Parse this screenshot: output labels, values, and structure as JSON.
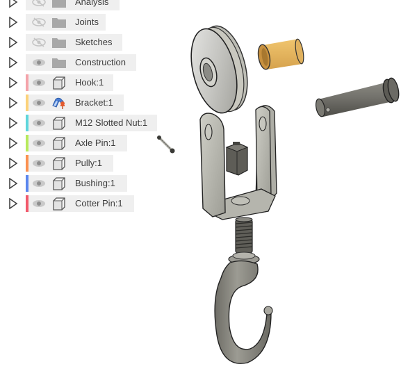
{
  "browser": {
    "items": [
      {
        "label": "Analysis",
        "type": "folder",
        "visible": false,
        "color": null
      },
      {
        "label": "Joints",
        "type": "folder",
        "visible": false,
        "color": null
      },
      {
        "label": "Sketches",
        "type": "folder",
        "visible": false,
        "color": null
      },
      {
        "label": "Construction",
        "type": "folder",
        "visible": true,
        "color": null
      },
      {
        "label": "Hook:1",
        "type": "component",
        "visible": true,
        "color": "#f4a3aa"
      },
      {
        "label": "Bracket:1",
        "type": "component-active",
        "visible": true,
        "color": "#fcd27a"
      },
      {
        "label": "M12 Slotted Nut:1",
        "type": "component",
        "visible": true,
        "color": "#5fd6dc"
      },
      {
        "label": "Axle Pin:1",
        "type": "component",
        "visible": true,
        "color": "#b7ea5c"
      },
      {
        "label": "Pully:1",
        "type": "component",
        "visible": true,
        "color": "#fb9150"
      },
      {
        "label": "Bushing:1",
        "type": "component",
        "visible": true,
        "color": "#5a86ee"
      },
      {
        "label": "Cotter Pin:1",
        "type": "component",
        "visible": true,
        "color": "#f2596b"
      }
    ]
  },
  "canvas": {
    "parts": [
      "pulley",
      "bushing",
      "axle-pin",
      "bracket",
      "slotted-nut",
      "cotter-pin",
      "hook"
    ],
    "colors": {
      "steel": "#b9b9b2",
      "bushing": "#e3b55f",
      "dark_metal": "#6f6e68",
      "hook": "#8c8b83"
    }
  }
}
